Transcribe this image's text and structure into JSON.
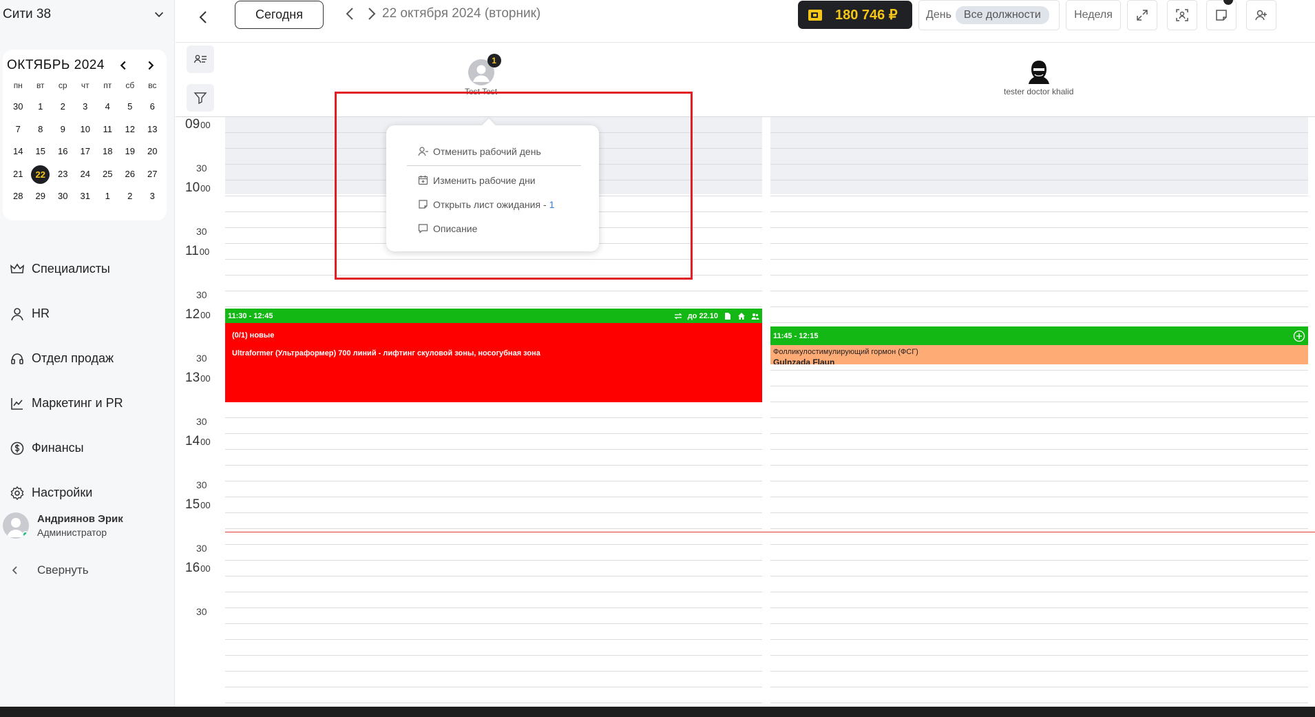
{
  "sidebar": {
    "branch": "Сити 38",
    "calendar": {
      "title": "ОКТЯБРЬ 2024",
      "weekdays": [
        "пн",
        "вт",
        "ср",
        "чт",
        "пт",
        "сб",
        "вс"
      ],
      "weeks": [
        [
          "30",
          "1",
          "2",
          "3",
          "4",
          "5",
          "6"
        ],
        [
          "7",
          "8",
          "9",
          "10",
          "11",
          "12",
          "13"
        ],
        [
          "14",
          "15",
          "16",
          "17",
          "18",
          "19",
          "20"
        ],
        [
          "21",
          "22",
          "23",
          "24",
          "25",
          "26",
          "27"
        ],
        [
          "28",
          "29",
          "30",
          "31",
          "1",
          "2",
          "3"
        ]
      ],
      "selected": "22"
    },
    "nav": [
      {
        "label": "Специалисты",
        "icon": "crown-icon"
      },
      {
        "label": "HR",
        "icon": "person-icon"
      },
      {
        "label": "Отдел продаж",
        "icon": "headset-icon"
      },
      {
        "label": "Маркетинг и PR",
        "icon": "chart-line-icon"
      },
      {
        "label": "Финансы",
        "icon": "dollar-circle-icon"
      },
      {
        "label": "Настройки",
        "icon": "gear-icon"
      }
    ],
    "user": {
      "name": "Андриянов Эрик",
      "role": "Администратор"
    },
    "collapse_label": "Свернуть"
  },
  "topbar": {
    "today_label": "Сегодня",
    "date": "22 октября 2024 (вторник)",
    "balance": "180 746 ₽",
    "day_label": "День",
    "positions_label": "Все должности",
    "week_label": "Неделя"
  },
  "specialists": [
    {
      "name": "Test Test",
      "badge": "1"
    },
    {
      "name": "tester doctor khalid"
    }
  ],
  "time_labels": {
    "hours": [
      "09",
      "10",
      "11",
      "12",
      "13",
      "14",
      "15",
      "16"
    ],
    "minutes_zero": "00",
    "half": "30"
  },
  "appointments": [
    {
      "time": "11:30 - 12:45",
      "until": "до 22.10",
      "line1": "(0/1) новые",
      "line2": "Ultraformer (Ультраформер) 700 линий - лифтинг скуловой зоны, носогубная зона",
      "color": "#ff0000"
    },
    {
      "time": "11:45 - 12:15",
      "line1": "Фолликулостимулирующий гормон (ФСГ)",
      "line2": "Gulnzada Flaun",
      "color": "#ffab76"
    }
  ],
  "context_menu": {
    "items": [
      {
        "label": "Отменить рабочий день",
        "icon": "person-minus-icon"
      },
      {
        "label": "Изменить рабочие дни",
        "icon": "calendar-plus-icon"
      },
      {
        "label": "Открыть лист ожидания - ",
        "count": "1",
        "icon": "waitlist-icon"
      },
      {
        "label": "Описание",
        "icon": "comment-icon"
      }
    ]
  },
  "colors": {
    "accent": "#f5c518",
    "dark": "#1f2124",
    "green": "#14b814",
    "highlight": "#e01e24"
  }
}
